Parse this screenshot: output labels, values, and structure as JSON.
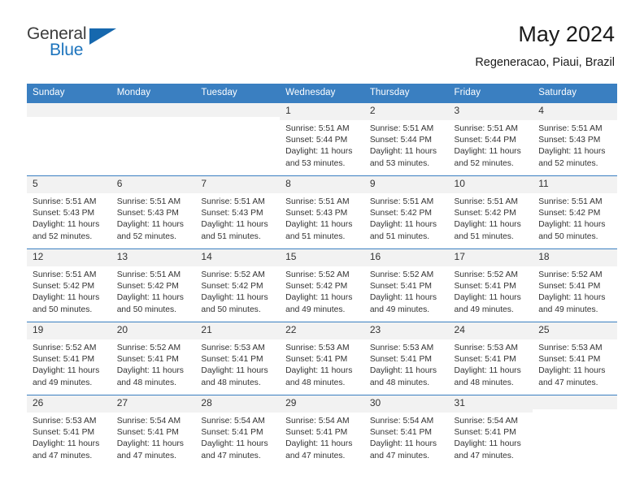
{
  "brand": {
    "name_part1": "General",
    "name_part2": "Blue",
    "triangle_color": "#1668ae"
  },
  "header": {
    "month_title": "May 2024",
    "location": "Regeneracao, Piaui, Brazil",
    "header_bg_color": "#3a7fc1",
    "header_text_color": "#ffffff"
  },
  "weekday_headers": [
    "Sunday",
    "Monday",
    "Tuesday",
    "Wednesday",
    "Thursday",
    "Friday",
    "Saturday"
  ],
  "weeks": [
    [
      {
        "day": "",
        "empty": true
      },
      {
        "day": "",
        "empty": true
      },
      {
        "day": "",
        "empty": true
      },
      {
        "day": "1",
        "sunrise": "Sunrise: 5:51 AM",
        "sunset": "Sunset: 5:44 PM",
        "daylight": "Daylight: 11 hours and 53 minutes."
      },
      {
        "day": "2",
        "sunrise": "Sunrise: 5:51 AM",
        "sunset": "Sunset: 5:44 PM",
        "daylight": "Daylight: 11 hours and 53 minutes."
      },
      {
        "day": "3",
        "sunrise": "Sunrise: 5:51 AM",
        "sunset": "Sunset: 5:44 PM",
        "daylight": "Daylight: 11 hours and 52 minutes."
      },
      {
        "day": "4",
        "sunrise": "Sunrise: 5:51 AM",
        "sunset": "Sunset: 5:43 PM",
        "daylight": "Daylight: 11 hours and 52 minutes."
      }
    ],
    [
      {
        "day": "5",
        "sunrise": "Sunrise: 5:51 AM",
        "sunset": "Sunset: 5:43 PM",
        "daylight": "Daylight: 11 hours and 52 minutes."
      },
      {
        "day": "6",
        "sunrise": "Sunrise: 5:51 AM",
        "sunset": "Sunset: 5:43 PM",
        "daylight": "Daylight: 11 hours and 52 minutes."
      },
      {
        "day": "7",
        "sunrise": "Sunrise: 5:51 AM",
        "sunset": "Sunset: 5:43 PM",
        "daylight": "Daylight: 11 hours and 51 minutes."
      },
      {
        "day": "8",
        "sunrise": "Sunrise: 5:51 AM",
        "sunset": "Sunset: 5:43 PM",
        "daylight": "Daylight: 11 hours and 51 minutes."
      },
      {
        "day": "9",
        "sunrise": "Sunrise: 5:51 AM",
        "sunset": "Sunset: 5:42 PM",
        "daylight": "Daylight: 11 hours and 51 minutes."
      },
      {
        "day": "10",
        "sunrise": "Sunrise: 5:51 AM",
        "sunset": "Sunset: 5:42 PM",
        "daylight": "Daylight: 11 hours and 51 minutes."
      },
      {
        "day": "11",
        "sunrise": "Sunrise: 5:51 AM",
        "sunset": "Sunset: 5:42 PM",
        "daylight": "Daylight: 11 hours and 50 minutes."
      }
    ],
    [
      {
        "day": "12",
        "sunrise": "Sunrise: 5:51 AM",
        "sunset": "Sunset: 5:42 PM",
        "daylight": "Daylight: 11 hours and 50 minutes."
      },
      {
        "day": "13",
        "sunrise": "Sunrise: 5:51 AM",
        "sunset": "Sunset: 5:42 PM",
        "daylight": "Daylight: 11 hours and 50 minutes."
      },
      {
        "day": "14",
        "sunrise": "Sunrise: 5:52 AM",
        "sunset": "Sunset: 5:42 PM",
        "daylight": "Daylight: 11 hours and 50 minutes."
      },
      {
        "day": "15",
        "sunrise": "Sunrise: 5:52 AM",
        "sunset": "Sunset: 5:42 PM",
        "daylight": "Daylight: 11 hours and 49 minutes."
      },
      {
        "day": "16",
        "sunrise": "Sunrise: 5:52 AM",
        "sunset": "Sunset: 5:41 PM",
        "daylight": "Daylight: 11 hours and 49 minutes."
      },
      {
        "day": "17",
        "sunrise": "Sunrise: 5:52 AM",
        "sunset": "Sunset: 5:41 PM",
        "daylight": "Daylight: 11 hours and 49 minutes."
      },
      {
        "day": "18",
        "sunrise": "Sunrise: 5:52 AM",
        "sunset": "Sunset: 5:41 PM",
        "daylight": "Daylight: 11 hours and 49 minutes."
      }
    ],
    [
      {
        "day": "19",
        "sunrise": "Sunrise: 5:52 AM",
        "sunset": "Sunset: 5:41 PM",
        "daylight": "Daylight: 11 hours and 49 minutes."
      },
      {
        "day": "20",
        "sunrise": "Sunrise: 5:52 AM",
        "sunset": "Sunset: 5:41 PM",
        "daylight": "Daylight: 11 hours and 48 minutes."
      },
      {
        "day": "21",
        "sunrise": "Sunrise: 5:53 AM",
        "sunset": "Sunset: 5:41 PM",
        "daylight": "Daylight: 11 hours and 48 minutes."
      },
      {
        "day": "22",
        "sunrise": "Sunrise: 5:53 AM",
        "sunset": "Sunset: 5:41 PM",
        "daylight": "Daylight: 11 hours and 48 minutes."
      },
      {
        "day": "23",
        "sunrise": "Sunrise: 5:53 AM",
        "sunset": "Sunset: 5:41 PM",
        "daylight": "Daylight: 11 hours and 48 minutes."
      },
      {
        "day": "24",
        "sunrise": "Sunrise: 5:53 AM",
        "sunset": "Sunset: 5:41 PM",
        "daylight": "Daylight: 11 hours and 48 minutes."
      },
      {
        "day": "25",
        "sunrise": "Sunrise: 5:53 AM",
        "sunset": "Sunset: 5:41 PM",
        "daylight": "Daylight: 11 hours and 47 minutes."
      }
    ],
    [
      {
        "day": "26",
        "sunrise": "Sunrise: 5:53 AM",
        "sunset": "Sunset: 5:41 PM",
        "daylight": "Daylight: 11 hours and 47 minutes."
      },
      {
        "day": "27",
        "sunrise": "Sunrise: 5:54 AM",
        "sunset": "Sunset: 5:41 PM",
        "daylight": "Daylight: 11 hours and 47 minutes."
      },
      {
        "day": "28",
        "sunrise": "Sunrise: 5:54 AM",
        "sunset": "Sunset: 5:41 PM",
        "daylight": "Daylight: 11 hours and 47 minutes."
      },
      {
        "day": "29",
        "sunrise": "Sunrise: 5:54 AM",
        "sunset": "Sunset: 5:41 PM",
        "daylight": "Daylight: 11 hours and 47 minutes."
      },
      {
        "day": "30",
        "sunrise": "Sunrise: 5:54 AM",
        "sunset": "Sunset: 5:41 PM",
        "daylight": "Daylight: 11 hours and 47 minutes."
      },
      {
        "day": "31",
        "sunrise": "Sunrise: 5:54 AM",
        "sunset": "Sunset: 5:41 PM",
        "daylight": "Daylight: 11 hours and 47 minutes."
      },
      {
        "day": "",
        "empty": true
      }
    ]
  ]
}
